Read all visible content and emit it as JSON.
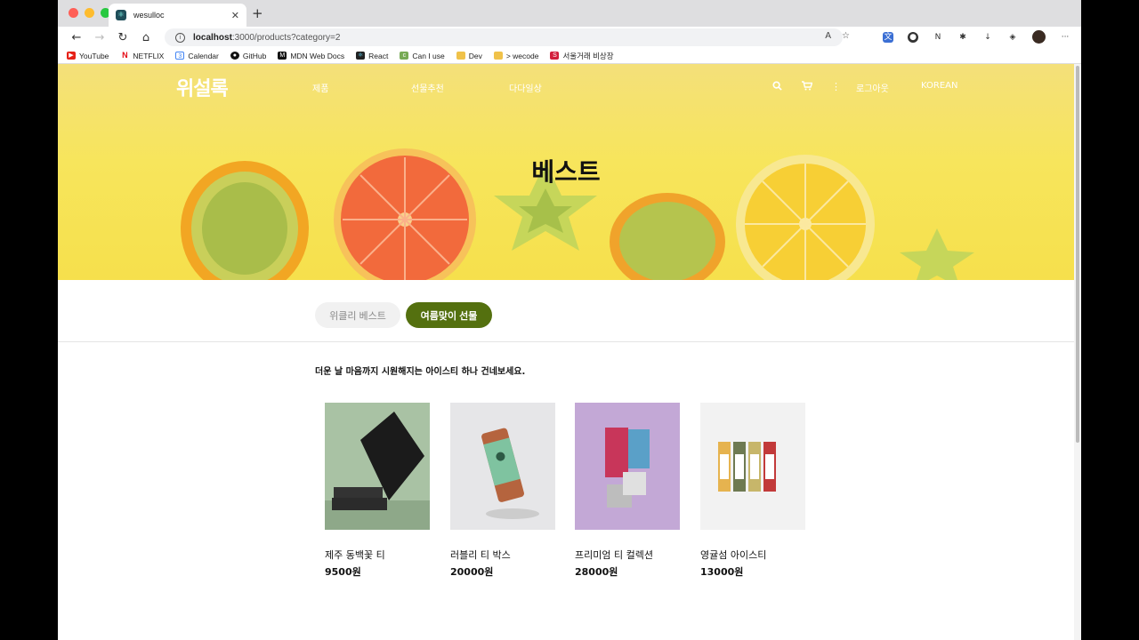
{
  "browser": {
    "tab_title": "wesulloc",
    "url_host": "localhost",
    "url_path": ":3000/products?category=2",
    "bookmarks": [
      "YouTube",
      "NETFLIX",
      "Calendar",
      "GitHub",
      "MDN Web Docs",
      "React",
      "Can I use",
      "Dev",
      "> wecode",
      "서울거래 비상장"
    ]
  },
  "site": {
    "logo": "위설록",
    "menu": [
      "제품",
      "선물추천",
      "다다일상"
    ],
    "logout": "로그아웃",
    "language": "KOREAN"
  },
  "hero": {
    "title": "베스트"
  },
  "categories": [
    {
      "label": "위클리 베스트",
      "active": false
    },
    {
      "label": "여름맞이 선물",
      "active": true
    }
  ],
  "description": "더운 날 마음까지 시원해지는 아이스티 하나 건네보세요.",
  "products": [
    {
      "name": "제주 동백꽃 티",
      "price": "9500원"
    },
    {
      "name": "러블리 티 박스",
      "price": "20000원"
    },
    {
      "name": "프리미엄 티 컬렉션",
      "price": "28000원"
    },
    {
      "name": "영귤섬 아이스티",
      "price": "13000원"
    }
  ],
  "colors": {
    "accent": "#54700f",
    "hero_bg": "#f6e04c"
  }
}
